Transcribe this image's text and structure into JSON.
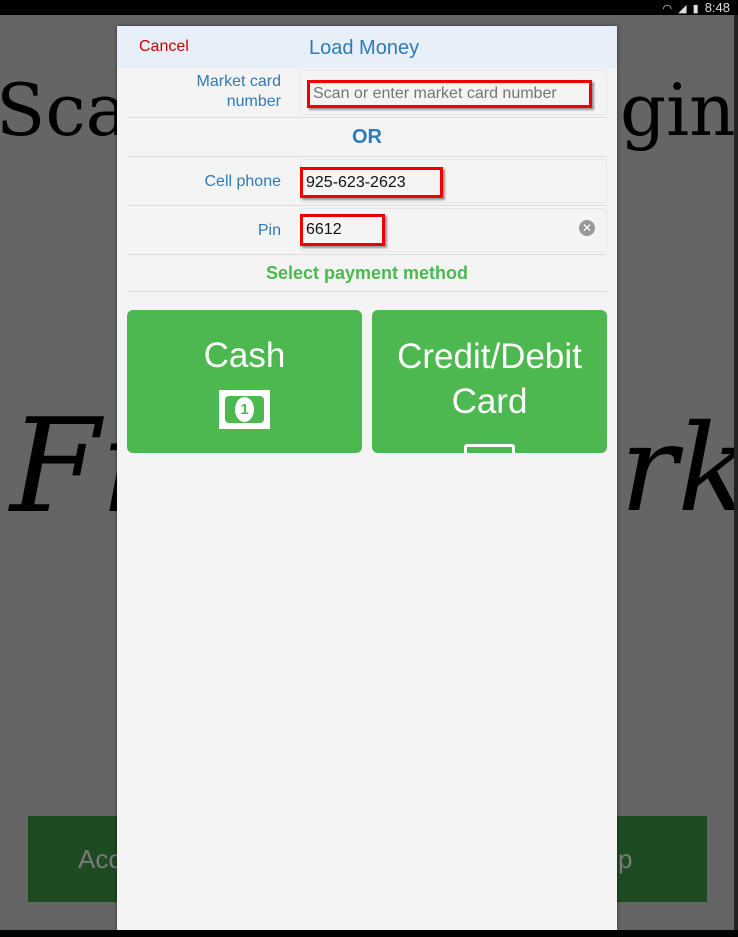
{
  "status_bar": {
    "time": "8:48",
    "icons": [
      "wifi-icon",
      "signal-icon",
      "battery-icon"
    ]
  },
  "background": {
    "heading_left": "Sca",
    "heading_right": "gin",
    "script_left": "Fr",
    "script_right": "rk",
    "button_left": "Acc",
    "button_right": "p",
    "button_color": "#1f4b22"
  },
  "modal": {
    "cancel_label": "Cancel",
    "title": "Load Money",
    "market_card": {
      "label": "Market card number",
      "placeholder": "Scan or enter market card number",
      "value": ""
    },
    "or_label": "OR",
    "cell_phone": {
      "label": "Cell phone",
      "value": "925-623-2623"
    },
    "pin": {
      "label": "Pin",
      "value": "6612"
    },
    "payment_heading": "Select payment method",
    "payment_options": [
      {
        "label": "Cash",
        "icon": "banknote-icon"
      },
      {
        "label": "Credit/Debit Card",
        "icon": "credit-card-icon"
      }
    ],
    "accent": "#4cb84f",
    "label_color": "#2f7ab8",
    "cancel_color": "#cc0000"
  }
}
